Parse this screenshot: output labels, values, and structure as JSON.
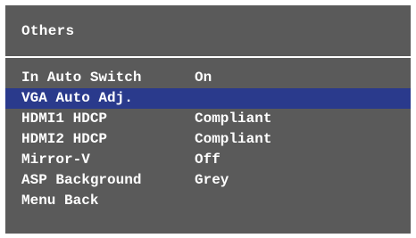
{
  "window": {
    "title": "Others"
  },
  "menu": {
    "items": [
      {
        "label": "In Auto Switch",
        "value": "On",
        "selected": false
      },
      {
        "label": "VGA Auto Adj.",
        "value": "",
        "selected": true
      },
      {
        "label": "HDMI1 HDCP",
        "value": "Compliant",
        "selected": false
      },
      {
        "label": "HDMI2 HDCP",
        "value": "Compliant",
        "selected": false
      },
      {
        "label": "Mirror-V",
        "value": "Off",
        "selected": false
      },
      {
        "label": "ASP Background",
        "value": "Grey",
        "selected": false
      },
      {
        "label": "Menu Back",
        "value": "",
        "selected": false
      }
    ]
  },
  "colors": {
    "panel_background": "#5a5a5a",
    "selection_highlight": "#2a3a8c",
    "text": "#ffffff"
  }
}
